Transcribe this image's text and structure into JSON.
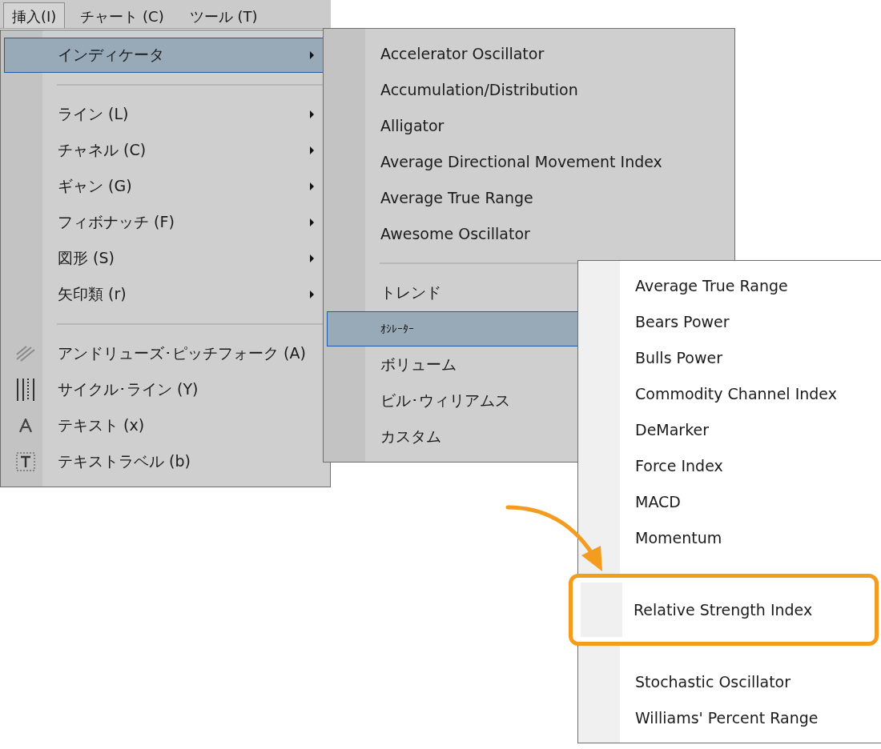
{
  "menubar": [
    {
      "label": "挿入(I)",
      "selected": true
    },
    {
      "label": "チャート (C)",
      "selected": false
    },
    {
      "label": "ツール (T)",
      "selected": false
    }
  ],
  "menus": [
    {
      "items": [
        {
          "kind": "item",
          "label": "インディケータ",
          "submenu": true,
          "selected": true
        },
        {
          "kind": "separator"
        },
        {
          "kind": "item",
          "label": "ライン (L)",
          "submenu": true,
          "selected": false
        },
        {
          "kind": "item",
          "label": "チャネル (C)",
          "submenu": true,
          "selected": false
        },
        {
          "kind": "item",
          "label": "ギャン (G)",
          "submenu": true,
          "selected": false
        },
        {
          "kind": "item",
          "label": "フィボナッチ (F)",
          "submenu": true,
          "selected": false
        },
        {
          "kind": "item",
          "label": "図形 (S)",
          "submenu": true,
          "selected": false
        },
        {
          "kind": "item",
          "label": "矢印類 (r)",
          "submenu": true,
          "selected": false
        },
        {
          "kind": "separator"
        },
        {
          "kind": "tool",
          "label": "アンドリューズ･ピッチフォーク (A)",
          "submenu": false,
          "selected": false
        },
        {
          "kind": "tool",
          "label": "サイクル･ライン (Y)",
          "submenu": false,
          "selected": false
        },
        {
          "kind": "tool",
          "label": "テキスト (x)",
          "submenu": false,
          "selected": false
        },
        {
          "kind": "tool",
          "label": "テキストラベル (b)",
          "submenu": false,
          "selected": false
        }
      ]
    },
    {
      "items": [
        {
          "kind": "item",
          "label": "Accelerator Oscillator",
          "selected": false
        },
        {
          "kind": "item",
          "label": "Accumulation/Distribution",
          "selected": false
        },
        {
          "kind": "item",
          "label": "Alligator",
          "selected": false
        },
        {
          "kind": "item",
          "label": "Average Directional Movement Index",
          "selected": false
        },
        {
          "kind": "item",
          "label": "Average True Range",
          "selected": false
        },
        {
          "kind": "item",
          "label": "Awesome Oscillator",
          "selected": false
        },
        {
          "kind": "separator"
        },
        {
          "kind": "item",
          "label": "トレンド",
          "selected": false
        },
        {
          "kind": "item",
          "label": "ｵｼﾚｰﾀｰ",
          "selected": true
        },
        {
          "kind": "item",
          "label": "ボリューム",
          "selected": false
        },
        {
          "kind": "item",
          "label": "ビル･ウィリアムス",
          "selected": false
        },
        {
          "kind": "item",
          "label": "カスタム",
          "selected": false
        }
      ]
    },
    {
      "items": [
        {
          "kind": "item",
          "label": "Average True Range",
          "highlighted": false
        },
        {
          "kind": "item",
          "label": "Bears Power",
          "highlighted": false
        },
        {
          "kind": "item",
          "label": "Bulls Power",
          "highlighted": false
        },
        {
          "kind": "item",
          "label": "Commodity Channel Index",
          "highlighted": false
        },
        {
          "kind": "item",
          "label": "DeMarker",
          "highlighted": false
        },
        {
          "kind": "item",
          "label": "Force Index",
          "highlighted": false
        },
        {
          "kind": "item",
          "label": "MACD",
          "highlighted": false
        },
        {
          "kind": "item",
          "label": "Momentum",
          "highlighted": false
        },
        {
          "kind": "item",
          "label": "Relative Strength Index",
          "highlighted": true
        },
        {
          "kind": "item",
          "label": "Stochastic Oscillator",
          "highlighted": false
        },
        {
          "kind": "item",
          "label": "Williams' Percent Range",
          "highlighted": false
        }
      ]
    }
  ]
}
